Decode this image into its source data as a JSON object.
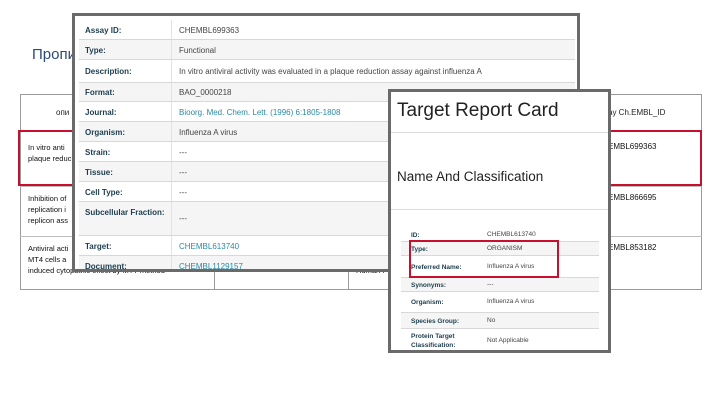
{
  "slide": {
    "title": "Пропи"
  },
  "table": {
    "col_description_header": "опи",
    "col_assay_id_header": "say Ch.EMBL_ID",
    "rows": [
      {
        "desc_line1": "In vitro anti",
        "desc_line2": "plaque reduc",
        "assay_id": "EMBL699363"
      },
      {
        "desc_line1": "Inhibition of",
        "desc_line2": "replication i",
        "desc_line3": "replicon ass",
        "assay_id": "EMBL866695"
      },
      {
        "desc_line1": "Antiviral acti",
        "desc_line2": "MT4 cells a",
        "desc_line3": "induced cytopathic effect by MTT method",
        "organism_fragment": "Human I",
        "assay_id": "EMBL853182"
      }
    ]
  },
  "assay_card": {
    "rows": [
      {
        "label": "Assay ID:",
        "value": "CHEMBL699363"
      },
      {
        "label": "Type:",
        "value": "Functional"
      },
      {
        "label": "Description:",
        "value": "In vitro antiviral activity was evaluated in a plaque reduction assay against influenza A"
      },
      {
        "label": "Format:",
        "value": "BAO_0000218"
      },
      {
        "label": "Journal:",
        "value": "Bioorg. Med. Chem. Lett. (1996) 6:1805-1808"
      },
      {
        "label": "Organism:",
        "value": "Influenza A virus"
      },
      {
        "label": "Strain:",
        "value": "---"
      },
      {
        "label": "Tissue:",
        "value": "---"
      },
      {
        "label": "Cell Type:",
        "value": "---"
      },
      {
        "label": "Subcellular Fraction:",
        "value": "---"
      },
      {
        "label": "Target:",
        "value": "CHEMBL613740"
      },
      {
        "label": "Document:",
        "value": "CHEMBL1129157"
      }
    ]
  },
  "target_card": {
    "title": "Target Report Card",
    "section": "Name And Classification",
    "rows": [
      {
        "label": "ID:",
        "value": "CHEMBL613740"
      },
      {
        "label": "Type:",
        "value": "ORGANISM"
      },
      {
        "label": "Preferred Name:",
        "value": "Influenza A virus"
      },
      {
        "label": "Synonyms:",
        "value": "---"
      },
      {
        "label": "Organism:",
        "value": "Influenza A virus"
      },
      {
        "label": "Species Group:",
        "value": "No"
      },
      {
        "label": "Protein Target Classification:",
        "value": "Not Applicable"
      }
    ]
  },
  "colors": {
    "highlight_red": "#c8102e",
    "link_teal": "#2a8aa5",
    "label_navy": "#1b3d4e",
    "title_blue": "#2a4a7a"
  }
}
